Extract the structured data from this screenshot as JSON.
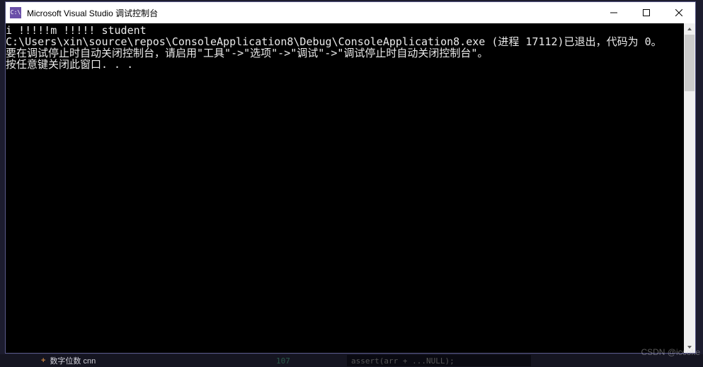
{
  "window": {
    "icon_text": "C:\\",
    "title": "Microsoft Visual Studio 调试控制台"
  },
  "console": {
    "line1": "i !!!!!m !!!!! student",
    "line2": "C:\\Users\\xin\\source\\repos\\ConsoleApplication8\\Debug\\ConsoleApplication8.exe (进程 17112)已退出，代码为 0。",
    "line3": "要在调试停止时自动关闭控制台，请启用\"工具\"->\"选项\"->\"调试\"->\"调试停止时自动关闭控制台\"。",
    "line4": "按任意键关闭此窗口. . ."
  },
  "bottom": {
    "file_hint": "数字位数 cnn",
    "mid_num": "107",
    "dark_text": "assert(arr + ...NULL);"
  },
  "watermark": "CSDN @iccoke"
}
